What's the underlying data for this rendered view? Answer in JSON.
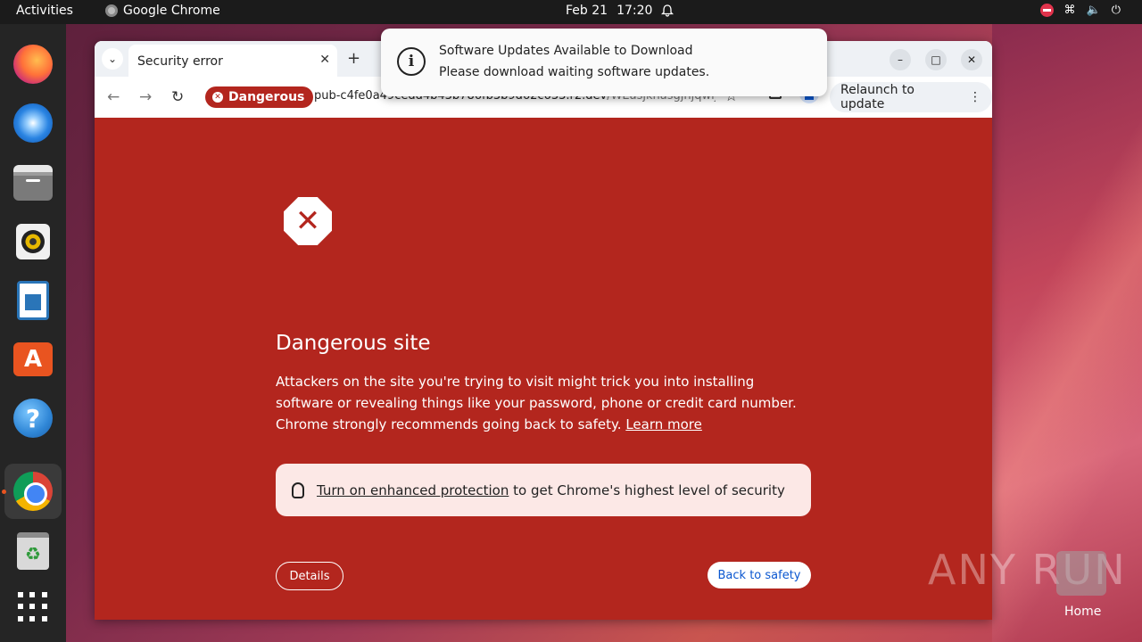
{
  "topbar": {
    "activities": "Activities",
    "app_name": "Google Chrome",
    "date": "Feb 21",
    "time": "17:20"
  },
  "dock": {
    "items": [
      "firefox-icon",
      "thunderbird-icon",
      "files-icon",
      "rhythmbox-icon",
      "writer-icon",
      "app-center-icon",
      "help-icon",
      "chrome-icon",
      "trash-icon",
      "show-apps-icon"
    ]
  },
  "browser": {
    "tab_title": "Security error",
    "new_tab": "+",
    "danger_chip": "Dangerous",
    "url_host": "pub-c4fe0a49cedd4b43b786fb3b9d62c633.r2.dev",
    "url_rest": "/WEasjkhasgjhjqwij...",
    "relaunch": "Relaunch to update"
  },
  "page": {
    "heading": "Dangerous site",
    "paragraph": "Attackers on the site you're trying to visit might trick you into installing software or revealing things like your password, phone or credit card number. Chrome strongly recommends going back to safety.",
    "learn_more": "Learn more",
    "enhanced_link": "Turn on enhanced protection",
    "enhanced_rest": "to get Chrome's highest level of security",
    "details": "Details",
    "back": "Back to safety"
  },
  "notification": {
    "title": "Software Updates Available to Download",
    "body": "Please download waiting software updates."
  },
  "desktop": {
    "watermark": "ANY RUN",
    "home_label": "Home"
  },
  "colors": {
    "danger_red": "#b3261e",
    "ubuntu_orange": "#e95420"
  }
}
